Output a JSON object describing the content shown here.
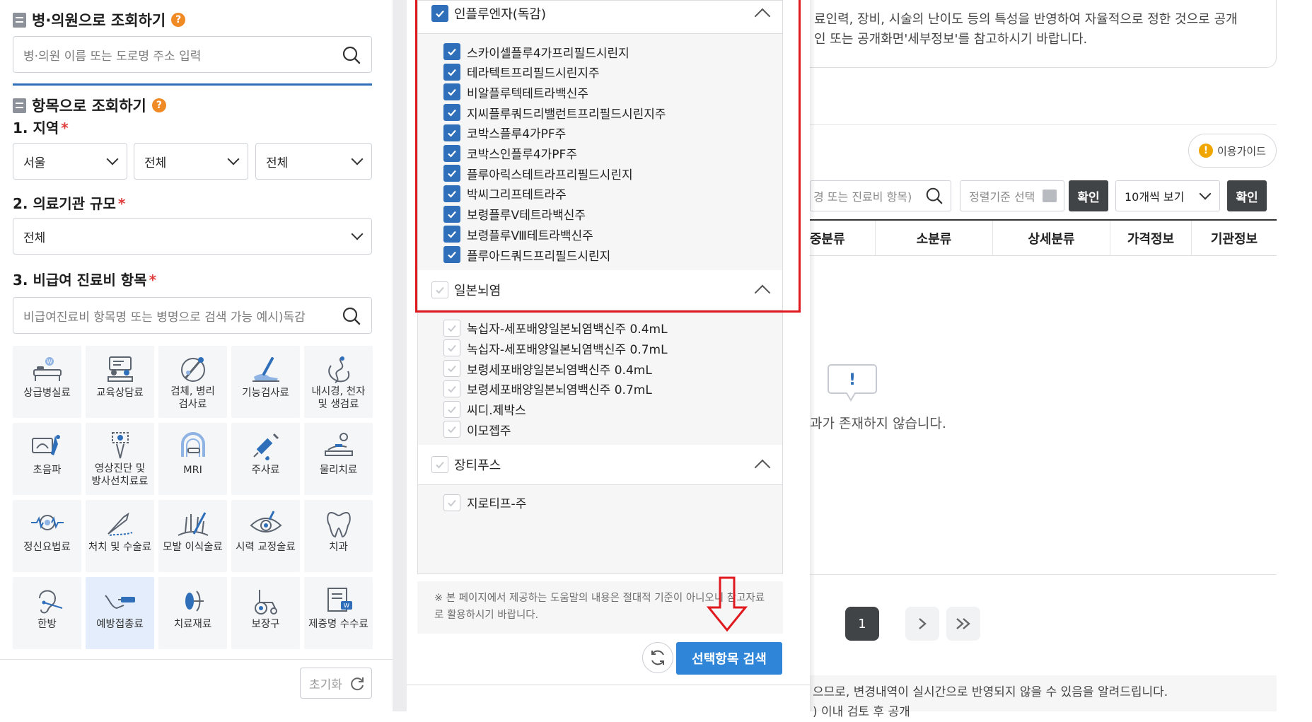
{
  "left": {
    "hospital_search": {
      "title": "병·의원으로 조회하기",
      "placeholder": "병·의원 이름 또는 도로명 주소 입력"
    },
    "item_search": {
      "title": "항목으로 조회하기",
      "region_label": "1. 지역",
      "region_values": [
        "서울",
        "전체",
        "전체"
      ],
      "scale_label": "2. 의료기관 규모",
      "scale_value": "전체",
      "fee_label": "3. 비급여 진료비 항목",
      "fee_placeholder": "비급여진료비 항목명 또는 병명으로 검색 가능 예시)독감"
    },
    "categories": [
      {
        "label": "상급병실료",
        "icon": "hospital-bed-icon",
        "active": false
      },
      {
        "label": "교육상담료",
        "icon": "consultation-icon",
        "active": false
      },
      {
        "label": "검체, 병리\n검사료",
        "icon": "lab-test-icon",
        "active": false
      },
      {
        "label": "기능검사료",
        "icon": "function-test-icon",
        "active": false
      },
      {
        "label": "내시경, 천자\n및 생검료",
        "icon": "endoscope-icon",
        "active": false
      },
      {
        "label": "초음파",
        "icon": "ultrasound-icon",
        "active": false
      },
      {
        "label": "영상진단 및\n방사선치료료",
        "icon": "radiology-icon",
        "active": false
      },
      {
        "label": "MRI",
        "icon": "mri-icon",
        "active": false
      },
      {
        "label": "주사료",
        "icon": "syringe-icon",
        "active": false
      },
      {
        "label": "물리치료",
        "icon": "physical-therapy-icon",
        "active": false
      },
      {
        "label": "정신요법료",
        "icon": "brain-wave-icon",
        "active": false
      },
      {
        "label": "처치 및 수술료",
        "icon": "surgery-icon",
        "active": false
      },
      {
        "label": "모발 이식술료",
        "icon": "hair-transplant-icon",
        "active": false
      },
      {
        "label": "시력 교정술료",
        "icon": "eye-icon",
        "active": false
      },
      {
        "label": "치과",
        "icon": "tooth-icon",
        "active": false
      },
      {
        "label": "한방",
        "icon": "acupuncture-icon",
        "active": false
      },
      {
        "label": "예방접종료",
        "icon": "vaccination-icon",
        "active": true
      },
      {
        "label": "치료재료",
        "icon": "pill-icon",
        "active": false
      },
      {
        "label": "보장구",
        "icon": "wheelchair-icon",
        "active": false
      },
      {
        "label": "제증명 수수료",
        "icon": "certificate-icon",
        "active": false
      }
    ],
    "reset_label": "초기화"
  },
  "middle": {
    "groups": [
      {
        "name": "인플루엔자(독감)",
        "checked": true,
        "items": [
          "스카이셀플루4가프리필드시린지",
          "테라텍트프리필드시린지주",
          "비알플루텍테트라백신주",
          "지씨플루쿼드리밸런트프리필드시린지주",
          "코박스플루4가PF주",
          "코박스인플루4가PF주",
          "플루아릭스테트라프리필드시린지",
          "박씨그리프테트라주",
          "보령플루Ⅴ테트라백신주",
          "보령플루Ⅷ테트라백신주",
          "플루아드쿼드프리필드시린지"
        ]
      },
      {
        "name": "일본뇌염",
        "checked": false,
        "items": [
          "녹십자-세포배양일본뇌염백신주 0.4mL",
          "녹십자-세포배양일본뇌염백신주 0.7mL",
          "보령세포배양일본뇌염백신주 0.4mL",
          "보령세포배양일본뇌염백신주 0.7mL",
          "씨디.제박스",
          "이모젭주"
        ]
      },
      {
        "name": "장티푸스",
        "checked": false,
        "items": [
          "지로티프-주"
        ]
      }
    ],
    "notice_text": "※ 본 페이지에서 제공하는 도움말의 내용은 절대적 기준이 아니오니 참고자료로 활용하시기 바랍니다.",
    "search_button": "선택항목 검색"
  },
  "right": {
    "info_line1": "료인력, 장비, 시술의 난이도 등의 특성을 반영하여 자율적으로 정한 것으로 공개",
    "info_line2": "인 또는 공개화면'세부정보'를 참고하시기 바랍니다.",
    "guide_button": "이용가이드",
    "search_placeholder": "경 또는 진료비 항목)",
    "sort_placeholder": "정렬기준 선택",
    "confirm_label": "확인",
    "page_size": "10개씩 보기",
    "confirm_label2": "확인",
    "columns": [
      "중분류",
      "소분류",
      "상세분류",
      "가격정보",
      "기관정보"
    ],
    "empty_message": "과가 존재하지 않습니다.",
    "pagination": {
      "current": "1"
    },
    "footnote_line1": "으므로, 변경내역이 실시간으로 반영되지 않을 수 있음을 알려드립니다.",
    "footnote_line2": ") 이내 검토 후 공개"
  },
  "colors": {
    "accent_blue": "#2f6fb9",
    "search_button": "#2f86d8",
    "highlight_red": "#e0191f",
    "dark_button": "#404447",
    "help_orange": "#f08a24"
  }
}
